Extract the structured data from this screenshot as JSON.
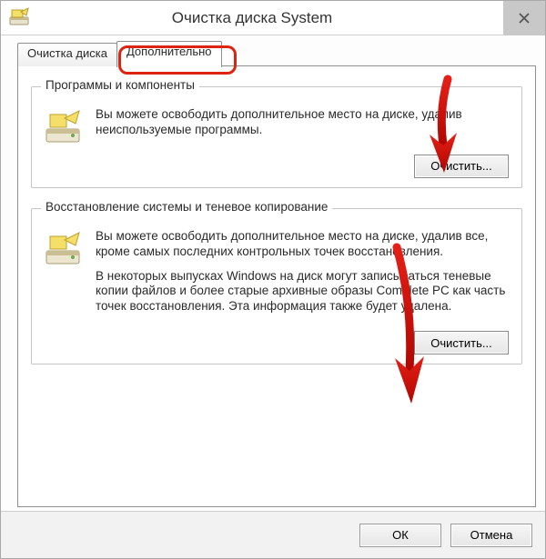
{
  "title": "Очистка диска System",
  "tabs": {
    "cleanup": "Очистка диска",
    "advanced": "Дополнительно"
  },
  "groups": {
    "programs": {
      "legend": "Программы и компоненты",
      "text": "Вы можете освободить дополнительное место на диске, удалив неиспользуемые программы.",
      "button": "Очистить..."
    },
    "restore": {
      "legend": "Восстановление системы и теневое копирование",
      "text1": "Вы можете освободить дополнительное место на диске, удалив все, кроме самых последних контрольных точек восстановления.",
      "text2": "В некоторых выпусках Windows на диск могут записываться теневые копии файлов и более старые архивные образы Complete PC как часть точек восстановления. Эта информация также будет удалена.",
      "button": "Очистить..."
    }
  },
  "buttons": {
    "ok": "ОК",
    "cancel": "Отмена"
  },
  "colors": {
    "highlight": "#dd2411",
    "arrow": "#dd0f0a"
  }
}
